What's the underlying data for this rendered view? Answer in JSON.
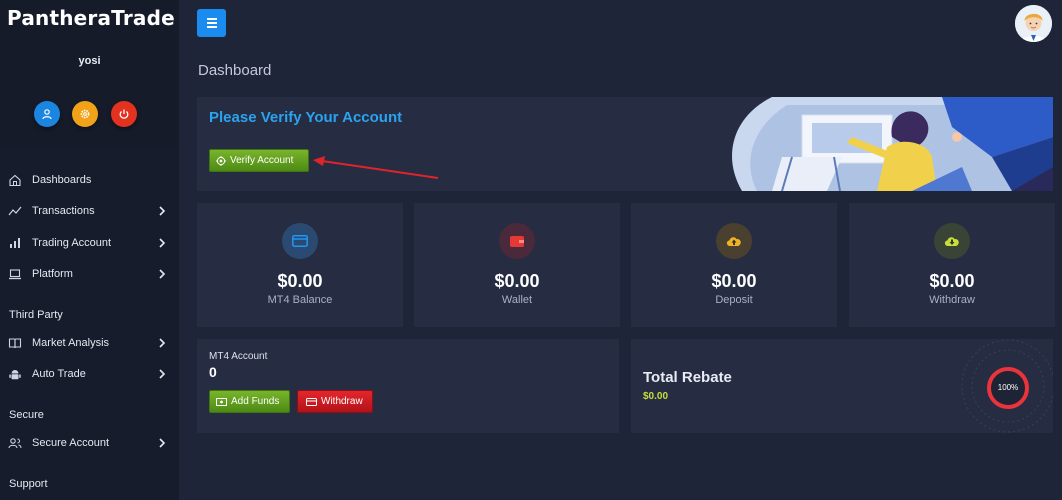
{
  "app": {
    "brand": "PantheraTrade"
  },
  "user": {
    "name": "yosi"
  },
  "sidebar": {
    "items": [
      {
        "label": "Dashboards",
        "icon": "home-icon"
      },
      {
        "label": "Transactions",
        "icon": "chart-line-icon"
      },
      {
        "label": "Trading Account",
        "icon": "bar-chart-icon"
      },
      {
        "label": "Platform",
        "icon": "laptop-icon"
      }
    ],
    "sections": [
      {
        "title": "Third Party",
        "items": [
          {
            "label": "Market Analysis",
            "icon": "book-icon"
          },
          {
            "label": "Auto Trade",
            "icon": "robot-icon"
          }
        ]
      },
      {
        "title": "Secure",
        "items": [
          {
            "label": "Secure Account",
            "icon": "users-icon"
          }
        ]
      },
      {
        "title": "Support",
        "items": []
      }
    ]
  },
  "header": {
    "page_title": "Dashboard"
  },
  "verify": {
    "title": "Please Verify Your Account",
    "button_label": "Verify Account"
  },
  "stats": [
    {
      "amount": "$0.00",
      "caption": "MT4 Balance",
      "icon": "card-icon",
      "color": "#2196f3"
    },
    {
      "amount": "$0.00",
      "caption": "Wallet",
      "icon": "wallet-icon",
      "color": "#e53935"
    },
    {
      "amount": "$0.00",
      "caption": "Deposit",
      "icon": "cloud-upload-icon",
      "color": "#f0b323"
    },
    {
      "amount": "$0.00",
      "caption": "Withdraw",
      "icon": "cloud-download-icon",
      "color": "#c7de3c"
    }
  ],
  "mt4": {
    "label": "MT4 Account",
    "value": "0",
    "add_funds_label": "Add Funds",
    "withdraw_label": "Withdraw"
  },
  "rebate": {
    "title": "Total Rebate",
    "value": "$0.00",
    "percent": "100%",
    "progress": 1.0
  },
  "colors": {
    "accent": "#1a8cf0",
    "green": "#5c9a1c",
    "red": "#d11c22",
    "sidebar_bg": "#171c2c",
    "panel_bg": "#262c42"
  }
}
